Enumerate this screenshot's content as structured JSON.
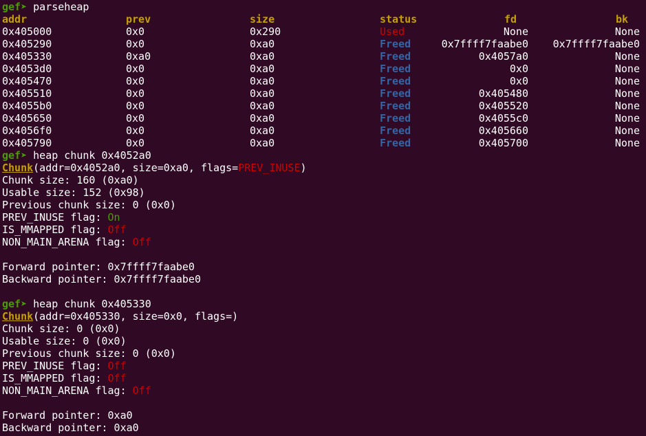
{
  "prompt": "gef",
  "cmd1": "parseheap",
  "headers": {
    "addr": "addr",
    "prev": "prev",
    "size": "size",
    "status": "status",
    "fd": "fd",
    "bk": "bk"
  },
  "rows": [
    {
      "addr": "0x405000",
      "prev": "0x0",
      "size": "0x290",
      "status": "Used",
      "fd": "None",
      "bk": "None"
    },
    {
      "addr": "0x405290",
      "prev": "0x0",
      "size": "0xa0",
      "status": "Freed",
      "fd": "0x7ffff7faabe0",
      "bk": "0x7ffff7faabe0"
    },
    {
      "addr": "0x405330",
      "prev": "0xa0",
      "size": "0xa0",
      "status": "Freed",
      "fd": "0x4057a0",
      "bk": "None"
    },
    {
      "addr": "0x4053d0",
      "prev": "0x0",
      "size": "0xa0",
      "status": "Freed",
      "fd": "0x0",
      "bk": "None"
    },
    {
      "addr": "0x405470",
      "prev": "0x0",
      "size": "0xa0",
      "status": "Freed",
      "fd": "0x0",
      "bk": "None"
    },
    {
      "addr": "0x405510",
      "prev": "0x0",
      "size": "0xa0",
      "status": "Freed",
      "fd": "0x405480",
      "bk": "None"
    },
    {
      "addr": "0x4055b0",
      "prev": "0x0",
      "size": "0xa0",
      "status": "Freed",
      "fd": "0x405520",
      "bk": "None"
    },
    {
      "addr": "0x405650",
      "prev": "0x0",
      "size": "0xa0",
      "status": "Freed",
      "fd": "0x4055c0",
      "bk": "None"
    },
    {
      "addr": "0x4056f0",
      "prev": "0x0",
      "size": "0xa0",
      "status": "Freed",
      "fd": "0x405660",
      "bk": "None"
    },
    {
      "addr": "0x405790",
      "prev": "0x0",
      "size": "0xa0",
      "status": "Freed",
      "fd": "0x405700",
      "bk": "None"
    }
  ],
  "chunk1": {
    "cmd": "heap chunk 0x4052a0",
    "word": "Chunk",
    "args_pre": "(addr=0x4052a0, size=0xa0, flags=",
    "flags": "PREV_INUSE",
    "args_post": ")",
    "chunk_size": "Chunk size: 160 (0xa0)",
    "usable_size": "Usable size: 152 (0x98)",
    "prev_size": "Previous chunk size: 0 (0x0)",
    "prev_inuse_label": "PREV_INUSE flag: ",
    "prev_inuse_val": "On",
    "is_mmapped_label": "IS_MMAPPED flag: ",
    "is_mmapped_val": "Off",
    "non_main_label": "NON_MAIN_ARENA flag: ",
    "non_main_val": "Off",
    "fwd": "Forward pointer: 0x7ffff7faabe0",
    "bwd": "Backward pointer: 0x7ffff7faabe0"
  },
  "chunk2": {
    "cmd": "heap chunk 0x405330",
    "word": "Chunk",
    "args": "(addr=0x405330, size=0x0, flags=)",
    "chunk_size": "Chunk size: 0 (0x0)",
    "usable_size": "Usable size: 0 (0x0)",
    "prev_size": "Previous chunk size: 0 (0x0)",
    "prev_inuse_label": "PREV_INUSE flag: ",
    "prev_inuse_val": "Off",
    "is_mmapped_label": "IS_MMAPPED flag: ",
    "is_mmapped_val": "Off",
    "non_main_label": "NON_MAIN_ARENA flag: ",
    "non_main_val": "Off",
    "fwd": "Forward pointer: 0xa0",
    "bwd": "Backward pointer: 0xa0"
  },
  "colors": {
    "background": "#300a24",
    "prompt": "#4e9a06",
    "header": "#c4a000",
    "used": "#cc0000",
    "freed": "#3465a4"
  }
}
